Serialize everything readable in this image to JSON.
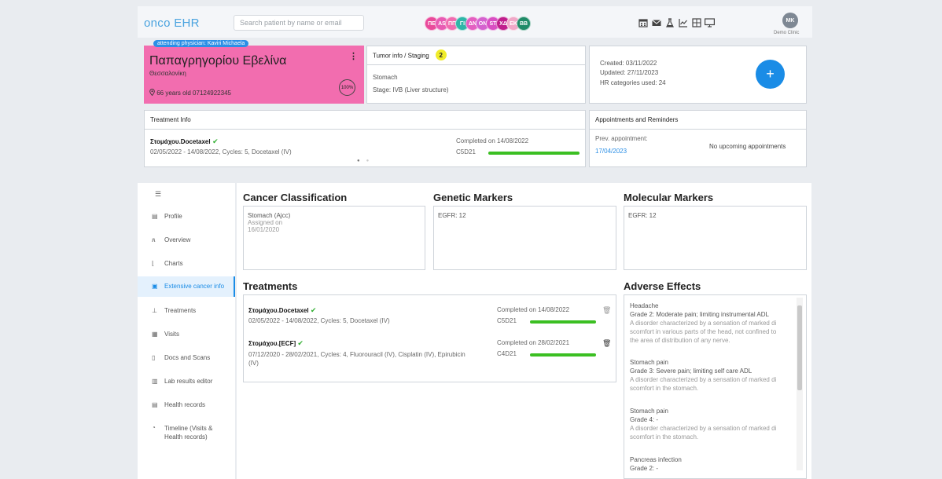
{
  "header": {
    "logo": "onco EHR",
    "search_placeholder": "Search patient by name or email",
    "patients": [
      {
        "initials": "ΠΕ",
        "color": "#e94a9b"
      },
      {
        "initials": "AS",
        "color": "#e85bb3"
      },
      {
        "initials": "ΠΠ",
        "color": "#f06cb0"
      },
      {
        "initials": "ΓΙ",
        "color": "#2fb6a8"
      },
      {
        "initials": "ΔΝ",
        "color": "#e45fc1"
      },
      {
        "initials": "ΟΝ",
        "color": "#d562cf"
      },
      {
        "initials": "ST",
        "color": "#d94ec3"
      },
      {
        "initials": "ΧΔ",
        "color": "#c01e8c"
      },
      {
        "initials": "EK",
        "color": "#f0a8c8"
      },
      {
        "initials": "BB",
        "color": "#1f8b68"
      }
    ],
    "icons": [
      "calendar-icon",
      "mail-icon",
      "flask-icon",
      "chart-icon",
      "calculator-icon",
      "monitor-icon"
    ],
    "user_initials": "MK",
    "clinic": "Demo Clinic"
  },
  "patient": {
    "attending": "attending physician: Kaviri Michaela",
    "name": "Παπαγρηγορίου Εβελίνα",
    "city": "Θεσσαλονίκη",
    "info": "66 years old   07124922345",
    "completeness": "100%",
    "card_color": "#f26daf"
  },
  "tumor": {
    "title": "Tumor info / Staging",
    "count": "2",
    "site": "Stomach",
    "stage": "Stage: IVB (Liver structure)"
  },
  "record": {
    "created": "Created: 03/11/2022",
    "updated": "Updated: 27/11/2023",
    "categories": "HR categories used: 24"
  },
  "treatment_info": {
    "title": "Treatment Info",
    "name": "Στομάχου.Docetaxel",
    "dates": "02/05/2022 - 14/08/2022, Cycles: 5, Docetaxel (IV)",
    "status": "Completed on 14/08/2022",
    "code": "C5D21",
    "progress": 1.0
  },
  "appointments": {
    "title": "Appointments and Reminders",
    "prev_label": "Prev. appointment:",
    "prev_date": "17/04/2023",
    "upcoming": "No upcoming appointments"
  },
  "sidebar": {
    "items": [
      {
        "label": "Profile",
        "icon": "profile-icon"
      },
      {
        "label": "Overview",
        "icon": "person-icon"
      },
      {
        "label": "Charts",
        "icon": "charts-icon"
      },
      {
        "label": "Extensive cancer info",
        "icon": "cancer-info-icon"
      },
      {
        "label": "Treatments",
        "icon": "treatments-icon"
      },
      {
        "label": "Visits",
        "icon": "visits-icon"
      },
      {
        "label": "Docs and Scans",
        "icon": "document-icon"
      },
      {
        "label": "Lab results editor",
        "icon": "lab-table-icon"
      },
      {
        "label": "Health records",
        "icon": "health-records-icon"
      },
      {
        "label": "Timeline (Visits &",
        "label2": "Health records)",
        "icon": "timeline-icon"
      }
    ],
    "active_index": 3
  },
  "cancer_classification": {
    "title": "Cancer Classification",
    "name": "Stomach (Ajcc)",
    "assigned": "Assigned on",
    "date": "16/01/2020"
  },
  "genetic_markers": {
    "title": "Genetic Markers",
    "value": "EGFR: 12"
  },
  "molecular_markers": {
    "title": "Molecular Markers",
    "value": "EGFR: 12"
  },
  "treatments": {
    "title": "Treatments",
    "rows": [
      {
        "name": "Στομάχου.Docetaxel",
        "dates": "02/05/2022 - 14/08/2022, Cycles: 5, Docetaxel (IV)",
        "dates2": "",
        "status": "Completed on 14/08/2022",
        "code": "C5D21",
        "progress": 1.0
      },
      {
        "name": "Στομάχου.[ECF]",
        "dates": "07/12/2020 - 28/02/2021, Cycles: 4, Fluorouracil (IV), Cisplatin (IV), Epirubicin",
        "dates2": "(IV)",
        "status": "Completed on 28/02/2021",
        "code": "C4D21",
        "progress": 1.0
      }
    ]
  },
  "adverse_effects": {
    "title": "Adverse Effects",
    "items": [
      {
        "name": "Headache",
        "grade": "Grade 2: Moderate pain; limiting instrumental ADL",
        "desc": [
          "A disorder characterized by a sensation of marked di",
          "scomfort in various parts of the head, not confined to",
          "the area of distribution of any nerve."
        ]
      },
      {
        "name": "Stomach pain",
        "grade": "Grade 3: Severe pain; limiting self care ADL",
        "desc": [
          "A disorder characterized by a sensation of marked di",
          "scomfort in the stomach."
        ]
      },
      {
        "name": "Stomach pain",
        "grade": "Grade 4: -",
        "desc": [
          "A disorder characterized by a sensation of marked di",
          "scomfort in the stomach."
        ]
      },
      {
        "name": "Pancreas infection",
        "grade": "Grade 2: -",
        "desc": []
      }
    ]
  }
}
